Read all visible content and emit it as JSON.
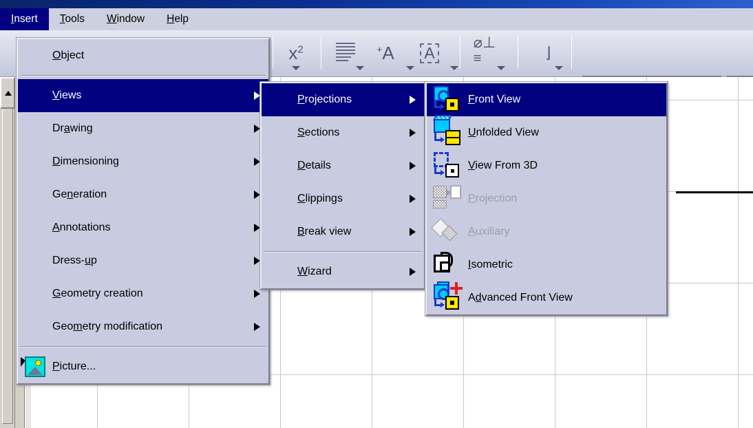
{
  "window": {
    "titlebar_color": "#0a246a"
  },
  "menubar": {
    "items": [
      {
        "label": "Insert",
        "accel": "I",
        "active": true
      },
      {
        "label": "Tools",
        "accel": "T",
        "active": false
      },
      {
        "label": "Window",
        "accel": "W",
        "active": false
      },
      {
        "label": "Help",
        "accel": "H",
        "active": false
      }
    ]
  },
  "toolbar": {
    "buttons": [
      {
        "name": "superscript-button",
        "glyph": "x²",
        "has_caret": true
      },
      {
        "name": "text-align-button",
        "glyph": "align-lines",
        "has_caret": true
      },
      {
        "name": "add-text-button",
        "glyph": "⁺A",
        "has_caret": true
      },
      {
        "name": "text-frame-button",
        "glyph": "A",
        "has_caret": true
      },
      {
        "name": "datum-feature-button",
        "glyph": "⌀⊥",
        "has_caret": true
      },
      {
        "name": "roughness-button",
        "glyph": "₂",
        "has_caret": true
      }
    ],
    "combo_value": "",
    "combo2_value": ""
  },
  "menus": {
    "insert": {
      "name": "Insert",
      "groups": [
        {
          "items": [
            {
              "label": "Object",
              "pre": "",
              "accel": "O",
              "post": "bject",
              "submenu": false,
              "icon": null,
              "selected": false,
              "disabled": false
            }
          ]
        },
        {
          "items": [
            {
              "label": "Views",
              "pre": "",
              "accel": "V",
              "post": "iews",
              "submenu": true,
              "icon": null,
              "selected": true,
              "disabled": false
            },
            {
              "label": "Drawing",
              "pre": "Dr",
              "accel": "a",
              "post": "wing",
              "submenu": true,
              "icon": null,
              "selected": false,
              "disabled": false
            },
            {
              "label": "Dimensioning",
              "pre": "",
              "accel": "D",
              "post": "imensioning",
              "submenu": true,
              "icon": null,
              "selected": false,
              "disabled": false
            },
            {
              "label": "Generation",
              "pre": "Ge",
              "accel": "n",
              "post": "eration",
              "submenu": true,
              "icon": null,
              "selected": false,
              "disabled": false
            },
            {
              "label": "Annotations",
              "pre": "",
              "accel": "A",
              "post": "nnotations",
              "submenu": true,
              "icon": null,
              "selected": false,
              "disabled": false
            },
            {
              "label": "Dress-up",
              "pre": "Dress-",
              "accel": "u",
              "post": "p",
              "submenu": true,
              "icon": null,
              "selected": false,
              "disabled": false
            },
            {
              "label": "Geometry creation",
              "pre": "",
              "accel": "G",
              "post": "eometry creation",
              "submenu": true,
              "icon": null,
              "selected": false,
              "disabled": false
            },
            {
              "label": "Geometry modification",
              "pre": "Geo",
              "accel": "m",
              "post": "etry modification",
              "submenu": true,
              "icon": null,
              "selected": false,
              "disabled": false
            }
          ]
        },
        {
          "items": [
            {
              "label": "Picture...",
              "pre": "",
              "accel": "P",
              "post": "icture...",
              "submenu": false,
              "icon": "picture-icon",
              "selected": false,
              "disabled": false
            }
          ]
        }
      ]
    },
    "views": {
      "name": "Views",
      "groups": [
        {
          "items": [
            {
              "label": "Projections",
              "pre": "",
              "accel": "P",
              "post": "rojections",
              "submenu": true,
              "selected": true,
              "disabled": false
            },
            {
              "label": "Sections",
              "pre": "",
              "accel": "S",
              "post": "ections",
              "submenu": true,
              "selected": false,
              "disabled": false
            },
            {
              "label": "Details",
              "pre": "",
              "accel": "D",
              "post": "etails",
              "submenu": true,
              "selected": false,
              "disabled": false
            },
            {
              "label": "Clippings",
              "pre": "",
              "accel": "C",
              "post": "lippings",
              "submenu": true,
              "selected": false,
              "disabled": false
            },
            {
              "label": "Break view",
              "pre": "",
              "accel": "B",
              "post": "reak view",
              "submenu": true,
              "selected": false,
              "disabled": false
            }
          ]
        },
        {
          "items": [
            {
              "label": "Wizard",
              "pre": "",
              "accel": "W",
              "post": "izard",
              "submenu": true,
              "selected": false,
              "disabled": false
            }
          ]
        }
      ]
    },
    "projections": {
      "name": "Projections",
      "items": [
        {
          "label": "Front View",
          "pre": "",
          "accel": "F",
          "post": "ront View",
          "icon": "front-view-icon",
          "selected": true,
          "disabled": false
        },
        {
          "label": "Unfolded View",
          "pre": "",
          "accel": "U",
          "post": "nfolded View",
          "icon": "unfolded-view-icon",
          "selected": false,
          "disabled": false
        },
        {
          "label": "View From 3D",
          "pre": "",
          "accel": "V",
          "post": "iew From 3D",
          "icon": "view-from-3d-icon",
          "selected": false,
          "disabled": false
        },
        {
          "label": "Projection",
          "pre": "",
          "accel": "P",
          "post": "rojection",
          "icon": "projection-icon",
          "selected": false,
          "disabled": true
        },
        {
          "label": "Auxiliary",
          "pre": "",
          "accel": "A",
          "post": "uxiliary",
          "icon": "auxiliary-icon",
          "selected": false,
          "disabled": true
        },
        {
          "label": "Isometric",
          "pre": "",
          "accel": "I",
          "post": "sometric",
          "icon": "isometric-icon",
          "selected": false,
          "disabled": false
        },
        {
          "label": "Advanced Front View",
          "pre": "A",
          "accel": "d",
          "post": "vanced Front View",
          "icon": "advanced-front-view-icon",
          "selected": false,
          "disabled": false
        }
      ]
    }
  }
}
